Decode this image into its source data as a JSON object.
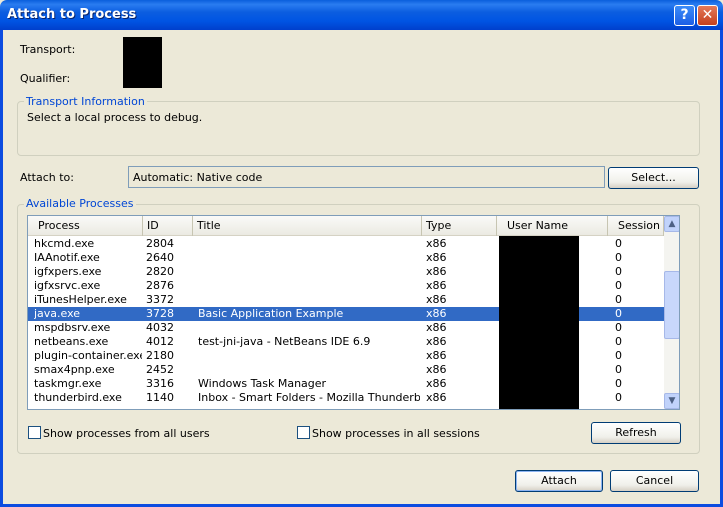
{
  "window": {
    "title": "Attach to Process",
    "help_glyph": "?",
    "close_glyph": "✕"
  },
  "transport": {
    "label": "Transport:",
    "qualifier_label": "Qualifier:"
  },
  "transport_info": {
    "legend": "Transport Information",
    "text": "Select a local process to debug."
  },
  "attach_to": {
    "label": "Attach to:",
    "value": "Automatic: Native code",
    "select_button": "Select..."
  },
  "processes": {
    "legend": "Available Processes",
    "columns": [
      "Process",
      "ID",
      "Title",
      "Type",
      "User Name",
      "Session"
    ],
    "rows": [
      {
        "process": "hkcmd.exe",
        "id": "2804",
        "title": "",
        "type": "x86",
        "session": "0",
        "selected": false
      },
      {
        "process": "IAAnotif.exe",
        "id": "2640",
        "title": "",
        "type": "x86",
        "session": "0",
        "selected": false
      },
      {
        "process": "igfxpers.exe",
        "id": "2820",
        "title": "",
        "type": "x86",
        "session": "0",
        "selected": false
      },
      {
        "process": "igfxsrvc.exe",
        "id": "2876",
        "title": "",
        "type": "x86",
        "session": "0",
        "selected": false
      },
      {
        "process": "iTunesHelper.exe",
        "id": "3372",
        "title": "",
        "type": "x86",
        "session": "0",
        "selected": false
      },
      {
        "process": "java.exe",
        "id": "3728",
        "title": "Basic Application Example",
        "type": "x86",
        "session": "0",
        "selected": true
      },
      {
        "process": "mspdbsrv.exe",
        "id": "4032",
        "title": "",
        "type": "x86",
        "session": "0",
        "selected": false
      },
      {
        "process": "netbeans.exe",
        "id": "4012",
        "title": "test-jni-java - NetBeans IDE 6.9",
        "type": "x86",
        "session": "0",
        "selected": false
      },
      {
        "process": "plugin-container.exe",
        "id": "2180",
        "title": "",
        "type": "x86",
        "session": "0",
        "selected": false
      },
      {
        "process": "smax4pnp.exe",
        "id": "2452",
        "title": "",
        "type": "x86",
        "session": "0",
        "selected": false
      },
      {
        "process": "taskmgr.exe",
        "id": "3316",
        "title": "Windows Task Manager",
        "type": "x86",
        "session": "0",
        "selected": false
      },
      {
        "process": "thunderbird.exe",
        "id": "1140",
        "title": "Inbox - Smart Folders - Mozilla Thunderbird",
        "type": "x86",
        "session": "0",
        "selected": false
      }
    ],
    "show_all_users": "Show processes from all users",
    "show_all_sessions": "Show processes in all sessions",
    "refresh_button": "Refresh"
  },
  "buttons": {
    "attach": "Attach",
    "cancel": "Cancel"
  },
  "colors": {
    "selection": "#316ac5",
    "legend_text": "#0046d5",
    "titlebar": "#0054e3"
  },
  "icons": {
    "scroll_up": "scroll-up-arrow-icon",
    "scroll_down": "scroll-down-arrow-icon"
  }
}
